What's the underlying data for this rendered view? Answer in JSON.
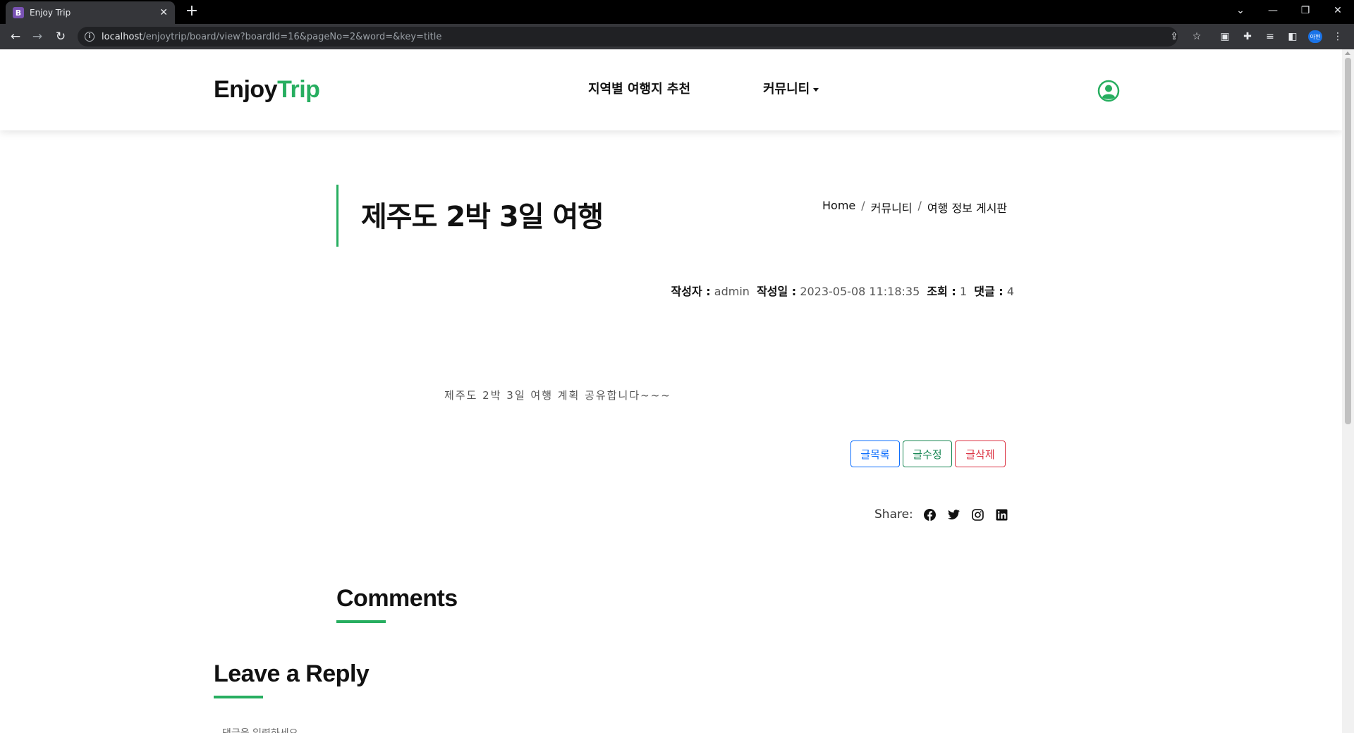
{
  "browser": {
    "tab_title": "Enjoy Trip",
    "tab_favicon_letter": "B",
    "url_host": "localhost",
    "url_path": "/enjoytrip/board/view?boardId=16&pageNo=2&word=&key=title",
    "profile_label": "아현"
  },
  "header": {
    "logo_main": "Enjoy",
    "logo_accent": "Trip",
    "nav": [
      {
        "label": "지역별 여행지 추천"
      },
      {
        "label": "커뮤니티"
      }
    ],
    "accent_color": "#27ae60"
  },
  "post": {
    "title": "제주도 2박 3일 여행",
    "breadcrumb": [
      "Home",
      "커뮤니티",
      "여행 정보 게시판"
    ],
    "meta": {
      "author_label": "작성자 :",
      "author": "admin",
      "date_label": "작성일 :",
      "date": "2023-05-08 11:18:35",
      "views_label": "조회 :",
      "views": "1",
      "comments_label": "댓글 :",
      "comments": "4"
    },
    "content": "제주도 2박 3일 여행 계획 공유합니다~~~",
    "buttons": {
      "list": "글목록",
      "edit": "글수정",
      "delete": "글삭제"
    },
    "share_label": "Share:",
    "share_icons": [
      "facebook-icon",
      "twitter-icon",
      "instagram-icon",
      "linkedin-icon"
    ]
  },
  "comments": {
    "heading": "Comments"
  },
  "reply": {
    "heading": "Leave a Reply",
    "placeholder_partial": "댓글을 입력하세요"
  }
}
